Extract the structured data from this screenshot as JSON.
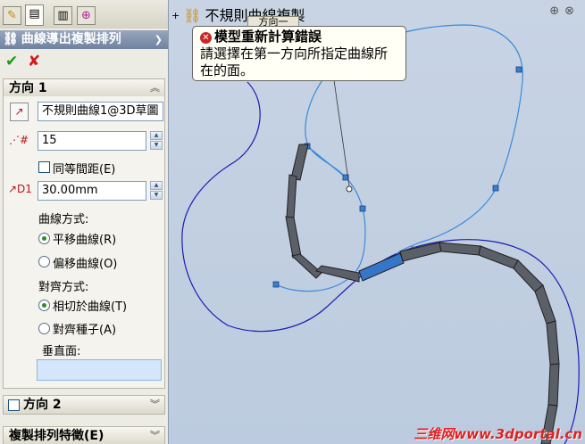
{
  "panel": {
    "tabs": [
      {
        "name": "feature-manager-icon",
        "glyph": "✎"
      },
      {
        "name": "property-manager-icon",
        "glyph": "▤"
      },
      {
        "name": "configuration-manager-icon",
        "glyph": "▥"
      },
      {
        "name": "dimxpert-icon",
        "glyph": "⊕"
      }
    ],
    "feature_title": "曲線導出複製排列",
    "ok_glyph": "✔",
    "cancel_glyph": "✘",
    "direction1": {
      "heading": "方向 1",
      "curve_value": "不規則曲線1@3D草圖",
      "instances_value": "15",
      "equal_spacing_label": "同等間距(E)",
      "spacing_value": "30.00mm",
      "curve_method_label": "曲線方式:",
      "curve_method_options": [
        "平移曲線(R)",
        "偏移曲線(O)"
      ],
      "alignment_label": "對齊方式:",
      "alignment_options": [
        "相切於曲線(T)",
        "對齊種子(A)"
      ],
      "normal_face_label": "垂直面:"
    },
    "direction2_heading": "方向 2",
    "pattern_features_heading": "複製排列特徵(E)"
  },
  "graphics": {
    "tree_root_label": "不規則曲線複製",
    "tree_child_label": "方向一",
    "error": {
      "title": "模型重新計算錯誤",
      "message": "請選擇在第一方向所指定曲線所在的面。"
    },
    "watermark": "三维网www.3dportal.cn"
  },
  "colors": {
    "background": "#c6d3e3",
    "curve": "#1414b4",
    "sketch_curve": "#3f8fd6",
    "chain": "#5a5e66",
    "selected_link": "#2f73c9"
  }
}
